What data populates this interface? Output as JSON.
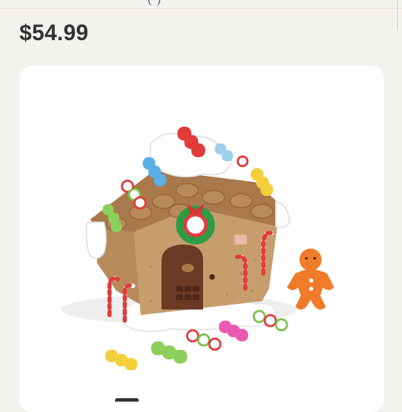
{
  "header": {
    "partial_text": "(  )"
  },
  "product": {
    "price": "$54.99",
    "image_icon": "gingerbread-house-toy-image",
    "brand_badge": "step2-logo"
  },
  "colors": {
    "background": "#f4f2ef",
    "card": "#ffffff",
    "price_text": "#333333"
  }
}
